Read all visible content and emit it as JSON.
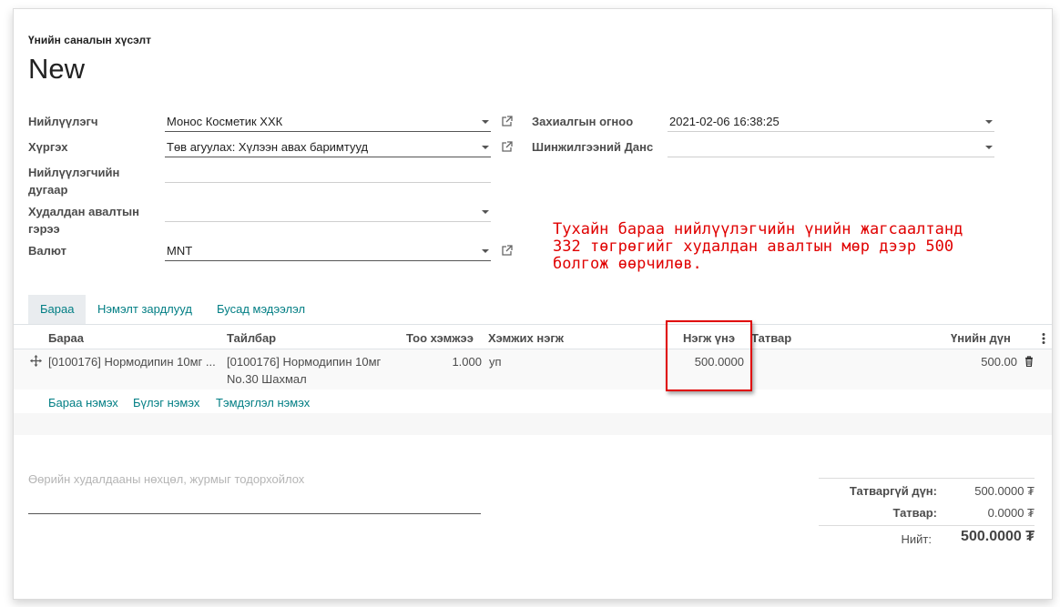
{
  "header": {
    "breadcrumb": "Үнийн саналын хүсэлт",
    "title": "New"
  },
  "form": {
    "vendor_label": "Нийлүүлэгч",
    "vendor_value": "Монос Косметик ХХК",
    "deliver_label": "Хүргэх",
    "deliver_value": "Төв агуулах: Хүлээн авах баримтууд",
    "vendor_ref_label_1": "Нийлүүлэгчийн",
    "vendor_ref_label_2": "дугаар",
    "vendor_ref_value": "",
    "agreement_label_1": "Худалдан авалтын",
    "agreement_label_2": "гэрээ",
    "agreement_value": "",
    "currency_label": "Валют",
    "currency_value": "MNT",
    "order_date_label": "Захиалгын огноо",
    "order_date_value": "2021-02-06 16:38:25",
    "analytic_label": "Шинжилгээний Данс",
    "analytic_value": ""
  },
  "annotation": {
    "text": "Тухайн бараа нийлүүлэгчийн үнийн жагсаалтанд\n332 төгрөгийг худалдан авалтын мөр дээр 500\nболгож өөрчилөв."
  },
  "tabs": [
    {
      "label": "Бараа"
    },
    {
      "label": "Нэмэлт зардлууд"
    },
    {
      "label": "Бусад мэдээлэл"
    }
  ],
  "table": {
    "columns": {
      "product": "Бараа",
      "description": "Тайлбар",
      "quantity": "Тоо хэмжээ",
      "uom": "Хэмжих нэгж",
      "unit_price": "Нэгж үнэ",
      "taxes": "Татвар",
      "subtotal": "Үнийн дүн"
    },
    "rows": [
      {
        "product": "[0100176] Нормодипин 10мг ...",
        "description_line1": "[0100176] Нормодипин 10мг",
        "description_line2": "No.30 Шахмал",
        "quantity": "1.000",
        "uom": "уп",
        "unit_price": "500.0000",
        "taxes": "",
        "subtotal": "500.00"
      }
    ],
    "add_product": "Бараа нэмэх",
    "add_section": "Бүлэг нэмэх",
    "add_note": "Тэмдэглэл нэмэх"
  },
  "terms": {
    "placeholder": "Өөрийн худалдааны нөхцөл, журмыг тодорхойлох"
  },
  "totals": {
    "untaxed_label": "Татваргүй дүн:",
    "untaxed_value": "500.0000 ₮",
    "tax_label": "Татвар:",
    "tax_value": "0.0000 ₮",
    "total_label": "Нийт:",
    "total_value": "500.0000 ₮"
  },
  "colors": {
    "accent": "#017e84",
    "annotation": "#e00000"
  }
}
